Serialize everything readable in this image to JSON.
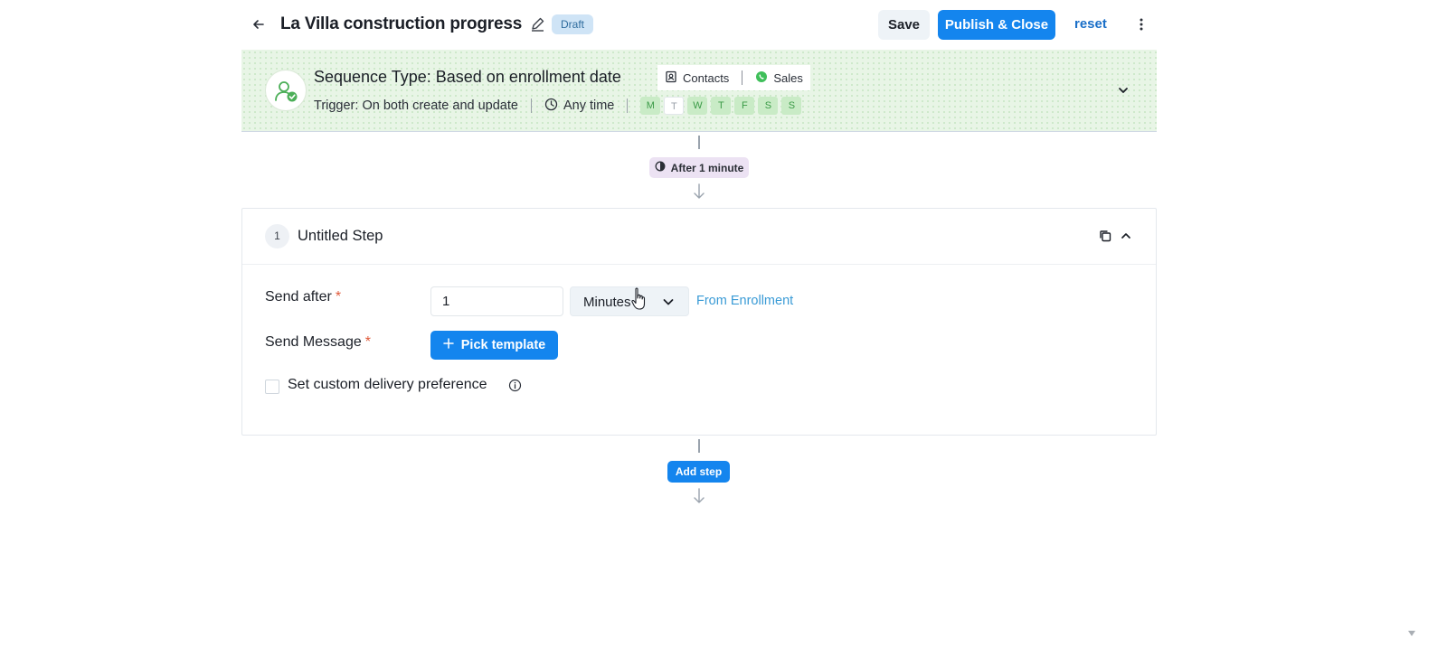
{
  "header": {
    "title": "La Villa construction progress",
    "status_badge": "Draft",
    "save_label": "Save",
    "publish_label": "Publish & Close",
    "reset_label": "reset"
  },
  "sequence": {
    "title": "Sequence Type: Based on enrollment date",
    "chips": [
      "Contacts",
      "Sales"
    ],
    "trigger": "Trigger: On both create and update",
    "time": "Any time",
    "days": [
      {
        "label": "M",
        "active": true
      },
      {
        "label": "T",
        "active": false
      },
      {
        "label": "W",
        "active": true
      },
      {
        "label": "T",
        "active": true
      },
      {
        "label": "F",
        "active": true
      },
      {
        "label": "S",
        "active": true
      },
      {
        "label": "S",
        "active": true
      }
    ]
  },
  "delay_pill": "After 1 minute",
  "step": {
    "number": "1",
    "title": "Untitled Step",
    "send_after_label": "Send after",
    "send_after_value": "1",
    "send_after_unit": "Minutes",
    "from_label": "From Enrollment",
    "send_message_label": "Send Message",
    "pick_template_label": "Pick template",
    "custom_delivery_label": "Set custom delivery preference",
    "required_mark": "*"
  },
  "add_step_label": "Add step",
  "colors": {
    "primary": "#1485ee",
    "draft_badge_bg": "#cfe4f6",
    "active_day_bg": "#c9ebc6",
    "delay_pill_bg": "#ece2f3",
    "link": "#3a9bd6"
  }
}
